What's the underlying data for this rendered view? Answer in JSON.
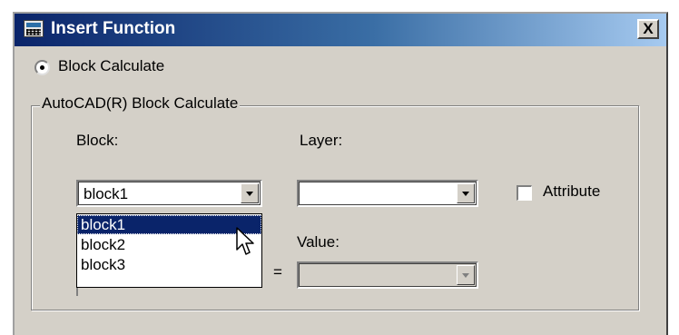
{
  "window": {
    "title": "Insert Function",
    "close_label": "X"
  },
  "radio": {
    "label": "Block Calculate",
    "checked": true
  },
  "group": {
    "title": "AutoCAD(R) Block Calculate",
    "block_label": "Block:",
    "block_value": "block1",
    "layer_label": "Layer:",
    "layer_value": "",
    "attribute_label": "Attribute",
    "attribute_checked": false,
    "value_label": "Value:",
    "value_value": "",
    "equals": "="
  },
  "dropdown": {
    "items": [
      "block1",
      "block2",
      "block3"
    ],
    "selected": "block1"
  },
  "colors": {
    "titlebar": "#0a246a",
    "face": "#d4d0c8",
    "selection": "#0a246a"
  }
}
